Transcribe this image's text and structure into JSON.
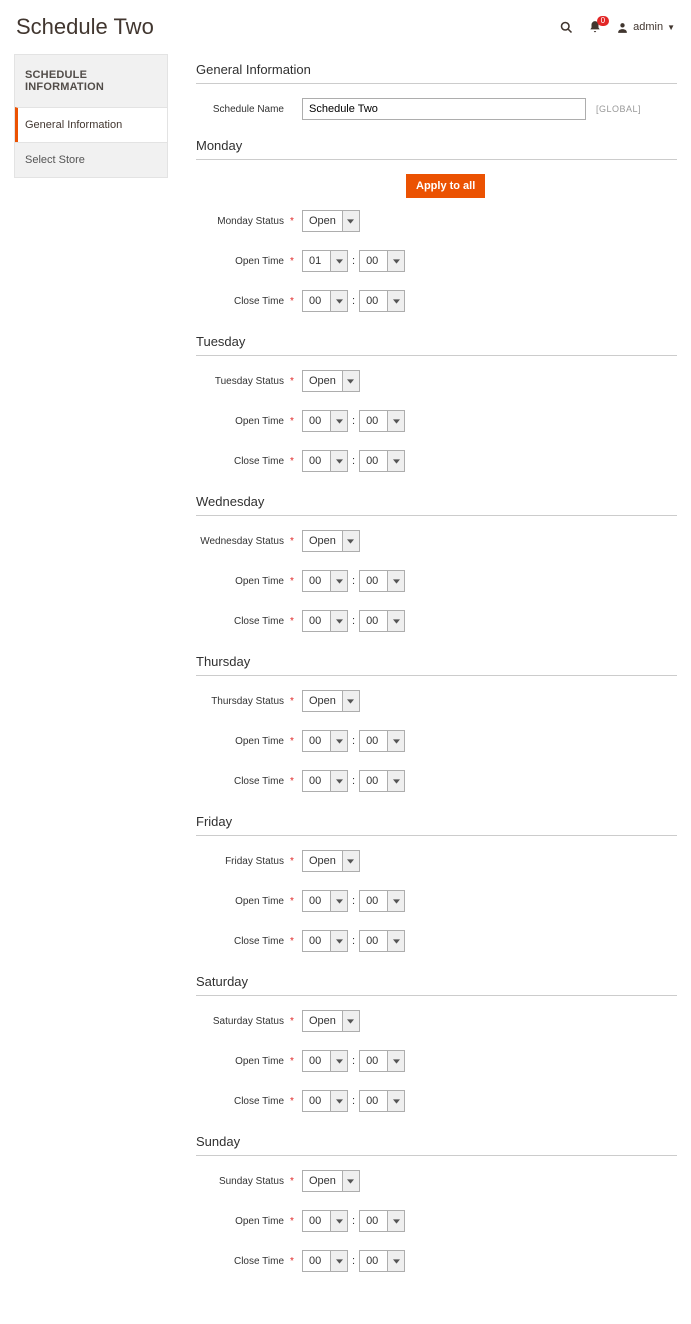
{
  "header": {
    "page_title": "Schedule Two",
    "notification_count": "0",
    "admin_label": "admin"
  },
  "sidebar": {
    "title": "SCHEDULE INFORMATION",
    "items": [
      {
        "label": "General Information",
        "active": true
      },
      {
        "label": "Select Store",
        "active": false
      }
    ]
  },
  "general": {
    "heading": "General Information",
    "name_label": "Schedule Name",
    "name_value": "Schedule Two",
    "scope": "[GLOBAL]"
  },
  "apply_button": "Apply to all",
  "labels": {
    "status_suffix": "Status",
    "open_time": "Open Time",
    "close_time": "Close Time",
    "colon": ":"
  },
  "days": [
    {
      "name": "Monday",
      "status": "Open",
      "open_h": "01",
      "open_m": "00",
      "close_h": "00",
      "close_m": "00",
      "apply_btn": true
    },
    {
      "name": "Tuesday",
      "status": "Open",
      "open_h": "00",
      "open_m": "00",
      "close_h": "00",
      "close_m": "00",
      "apply_btn": false
    },
    {
      "name": "Wednesday",
      "status": "Open",
      "open_h": "00",
      "open_m": "00",
      "close_h": "00",
      "close_m": "00",
      "apply_btn": false
    },
    {
      "name": "Thursday",
      "status": "Open",
      "open_h": "00",
      "open_m": "00",
      "close_h": "00",
      "close_m": "00",
      "apply_btn": false
    },
    {
      "name": "Friday",
      "status": "Open",
      "open_h": "00",
      "open_m": "00",
      "close_h": "00",
      "close_m": "00",
      "apply_btn": false
    },
    {
      "name": "Saturday",
      "status": "Open",
      "open_h": "00",
      "open_m": "00",
      "close_h": "00",
      "close_m": "00",
      "apply_btn": false
    },
    {
      "name": "Sunday",
      "status": "Open",
      "open_h": "00",
      "open_m": "00",
      "close_h": "00",
      "close_m": "00",
      "apply_btn": false
    }
  ]
}
